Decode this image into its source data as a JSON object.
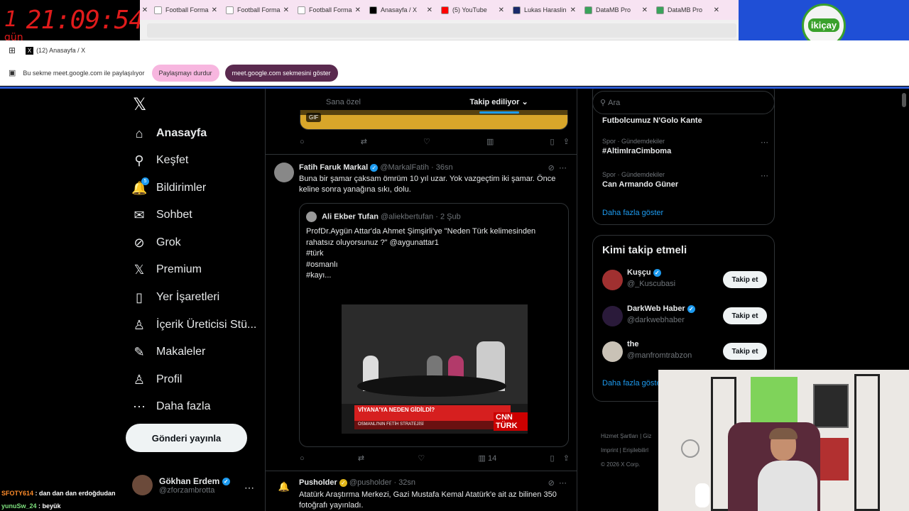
{
  "overlay": {
    "timer_days": "1",
    "timer_days_label": "gün",
    "timer_clock": "21:09:54"
  },
  "browser": {
    "tabs": [
      {
        "title": "Football Forma",
        "favicon_color": "#ffffff",
        "icon": "page-icon"
      },
      {
        "title": "Football Forma",
        "favicon_color": "#ffffff",
        "icon": "page-icon"
      },
      {
        "title": "Football Forma",
        "favicon_color": "#ffffff",
        "icon": "page-icon"
      },
      {
        "title": "Anasayfa / X",
        "favicon_color": "#000000",
        "icon": "x-icon"
      },
      {
        "title": "(5) YouTube",
        "favicon_color": "#ff0000",
        "icon": "youtube-icon"
      },
      {
        "title": "Lukas Haraslin",
        "favicon_color": "#1a2a6a",
        "icon": "page-icon"
      },
      {
        "title": "DataMB Pro",
        "favicon_color": "#3aa35b",
        "icon": "page-icon"
      },
      {
        "title": "DataMB Pro",
        "favicon_color": "#3aa35b",
        "icon": "page-icon"
      }
    ],
    "bookmark_tab": "(12) Anasayfa / X"
  },
  "logo": {
    "text": "ikiçay"
  },
  "share_bar": {
    "message": "Bu sekme meet.google.com ile paylaşılıyor",
    "stop_button": "Paylaşmayı durdur",
    "show_button": "meet.google.com sekmesini göster"
  },
  "nav": {
    "items": [
      {
        "label": "Anasayfa",
        "icon": "home-icon",
        "glyph": "⌂"
      },
      {
        "label": "Keşfet",
        "icon": "search-icon",
        "glyph": "⚲"
      },
      {
        "label": "Bildirimler",
        "icon": "bell-icon",
        "glyph": "🔔"
      },
      {
        "label": "Sohbet",
        "icon": "mail-icon",
        "glyph": "✉"
      },
      {
        "label": "Grok",
        "icon": "grok-icon",
        "glyph": "⊘"
      },
      {
        "label": "Premium",
        "icon": "x-premium-icon",
        "glyph": "𝕏"
      },
      {
        "label": "Yer İşaretleri",
        "icon": "bookmark-icon",
        "glyph": "▯"
      },
      {
        "label": "İçerik Üreticisi Stü...",
        "icon": "creator-icon",
        "glyph": "♙"
      },
      {
        "label": "Makaleler",
        "icon": "article-icon",
        "glyph": "✎"
      },
      {
        "label": "Profil",
        "icon": "profile-icon",
        "glyph": "♙"
      },
      {
        "label": "Daha fazla",
        "icon": "more-circle-icon",
        "glyph": "⋯"
      }
    ],
    "notification_count": "5",
    "post_button": "Gönderi yayınla",
    "profile_name": "Gökhan Erdem",
    "profile_handle": "@zforzambrotta"
  },
  "feed": {
    "tabs": [
      "Sana özel",
      "Takip ediliyor"
    ],
    "gif_label": "GIF",
    "tweet1": {
      "name": "Fatih Faruk Markal",
      "handle": "@MarkalFatih",
      "time": "36sn",
      "text": "Buna bir şamar çaksam ömrüm 10 yıl uzar. Yok vazgeçtim iki şamar. Önce keline sonra yanağına sıkı, dolu.",
      "quote_name": "Ali Ekber Tufan",
      "quote_handle": "@aliekbertufan",
      "quote_time": "2 Şub",
      "quote_text_lines": [
        "ProfDr.Aygün Attar'da Ahmet Şimşirli'ye \"Neden Türk kelimesinden",
        "rahatsız oluyorsunuz ?\" @aygunattar1",
        "#türk",
        "#osmanlı",
        "#kayı..."
      ],
      "video_lower_third": "VİYANA'YA NEDEN GİDİLDİ?",
      "video_subtitle": "OSMANLI'NIN FETİH STRATEJİSİ",
      "video_brand": "CNN TÜRK",
      "views": "14"
    },
    "tweet2": {
      "name": "Pusholder",
      "handle": "@pusholder",
      "time": "32sn",
      "text": "Atatürk Araştırma Merkezi, Gazi Mustafa Kemal Atatürk'e ait az bilinen 350 fotoğrafı yayınladı."
    }
  },
  "right": {
    "search_placeholder": "Ara",
    "trend_top": "Futbolcumuz N'Golo Kante",
    "trends": [
      {
        "category": "Spor · Gündemdekiler",
        "title": "#AltimIraCimboma"
      },
      {
        "category": "Spor · Gündemdekiler",
        "title": "Can Armando Güner"
      }
    ],
    "show_more": "Daha fazla göster",
    "who_to_follow_title": "Kimi takip etmeli",
    "follow_suggestions": [
      {
        "name": "Kuşçu",
        "handle": "@_Kuscubasi"
      },
      {
        "name": "DarkWeb Haber",
        "handle": "@darkwebhaber"
      },
      {
        "name": "the",
        "handle": "@manfromtrabzon"
      }
    ],
    "follow_button": "Takip et",
    "show_more_2": "Daha fazla göster",
    "footer_line1": "Hizmet Şartları | Giz",
    "footer_line2": "Imprint | Erişilebilirl",
    "footer_line3": "© 2026 X Corp."
  },
  "chat": [
    {
      "user": "SFOTY614",
      "message": ": dan dan dan erdoğdudan"
    },
    {
      "user": "yunuSw_24",
      "message": ": beyük"
    }
  ]
}
